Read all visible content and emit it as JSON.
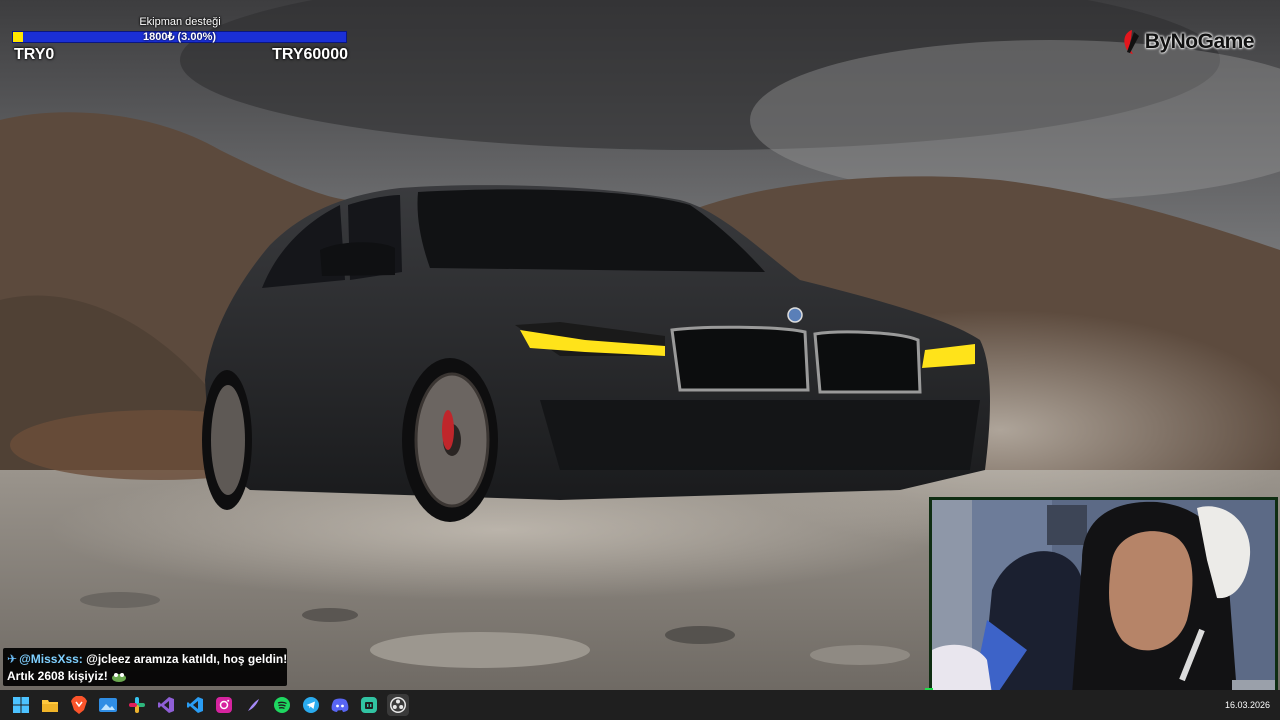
{
  "goal": {
    "title": "Ekipman desteği",
    "amount_label": "1800₺ (3.00%)",
    "progress_fraction": 0.03,
    "min_label": "TRY0",
    "max_label": "TRY60000",
    "colors": {
      "track": "#1a2fd6",
      "fill": "#ffe600"
    }
  },
  "brand": {
    "name": "ByNoGame",
    "icon": "bynogame-logo-icon",
    "accent": "#e4161d"
  },
  "chat": {
    "pin_icon": "pin-icon",
    "username": "@MissXss:",
    "message": "@jcleez aramıza katıldı, hoş geldin!",
    "subline": "Artık 2608 kişiyiz!",
    "emote": "frog-emote-icon"
  },
  "taskbar": {
    "icons": [
      "windows-start-icon",
      "file-explorer-icon",
      "brave-browser-icon",
      "photos-icon",
      "slack-icon",
      "visual-studio-icon",
      "vscode-icon",
      "instagram-icon",
      "obsidian-icon",
      "spotify-icon",
      "telegram-icon",
      "discord-icon",
      "streamlabs-icon",
      "obs-icon"
    ],
    "date": "16.03.2026"
  }
}
